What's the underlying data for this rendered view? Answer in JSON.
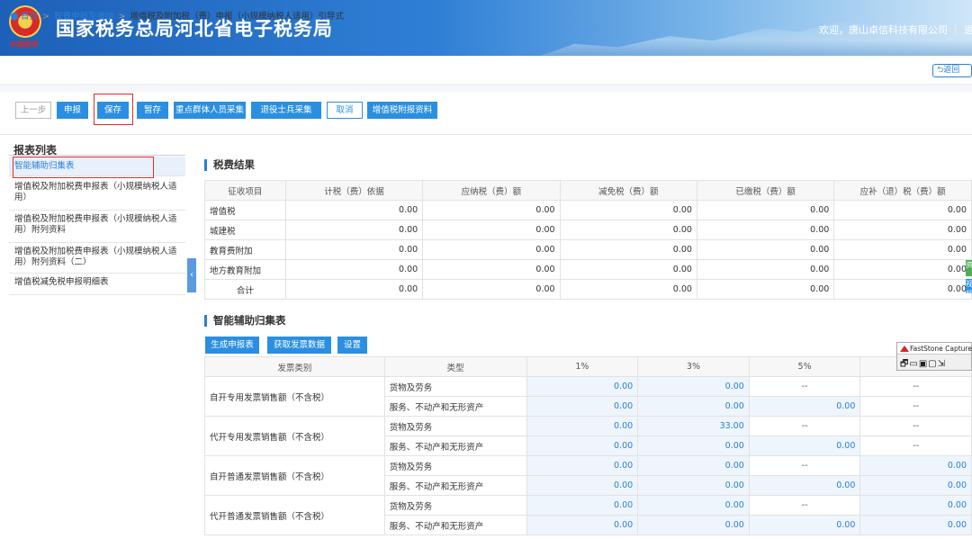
{
  "header": {
    "title": "国家税务总局河北省电子税务局",
    "emblem_text": "中国税务",
    "welcome": "欢迎，唐山卓信科技有限公司 ｜ 退"
  },
  "breadcrumb": {
    "home": "首页",
    "level1": "税费申报及缴纳",
    "current": "增值税及附加税（费）申报（小规模纳税人适用）引导式",
    "back": "返回"
  },
  "toolbar": {
    "prev": "上一步",
    "declare": "申报",
    "save": "保存",
    "temp_save": "暂存",
    "key_group": "重点群体人员采集",
    "veteran": "退役士兵采集",
    "cancel": "取消",
    "vat_attach": "增值税附报资料"
  },
  "sidebar": {
    "title": "报表列表",
    "items": [
      "智能辅助归集表",
      "增值税及附加税费申报表（小规模纳税人适用）",
      "增值税及附加税费申报表（小规模纳税人适用）附列资料",
      "增值税及附加税费申报表（小规模纳税人适用）附列资料（二）",
      "增值税减免税申报明细表"
    ]
  },
  "tax_result": {
    "title": "税费结果",
    "headers": [
      "征收项目",
      "计税（费）依据",
      "应纳税（费）额",
      "减免税（费）额",
      "已缴税（费）额",
      "应补（退）税（费）额"
    ],
    "rows": [
      [
        "增值税",
        "0.00",
        "0.00",
        "0.00",
        "0.00",
        "0.00"
      ],
      [
        "城建税",
        "0.00",
        "0.00",
        "0.00",
        "0.00",
        "0.00"
      ],
      [
        "教育费附加",
        "0.00",
        "0.00",
        "0.00",
        "0.00",
        "0.00"
      ],
      [
        "地方教育附加",
        "0.00",
        "0.00",
        "0.00",
        "0.00",
        "0.00"
      ],
      [
        "合计",
        "0.00",
        "0.00",
        "0.00",
        "0.00",
        "0.00"
      ]
    ]
  },
  "assist": {
    "title": "智能辅助归集表",
    "buttons": [
      "生成申报表",
      "获取发票数据",
      "设置"
    ],
    "headers": [
      "发票类别",
      "类型",
      "1%",
      "3%",
      "5%",
      ""
    ],
    "groups": [
      {
        "category": "自开专用发票销售额（不含税）",
        "rows": [
          {
            "type": "货物及劳务",
            "v1": "0.00",
            "v3": "0.00",
            "v5": "--",
            "v6": "--"
          },
          {
            "type": "服务、不动产和无形资产",
            "v1": "0.00",
            "v3": "0.00",
            "v5": "0.00",
            "v6": "--"
          }
        ]
      },
      {
        "category": "代开专用发票销售额（不含税）",
        "rows": [
          {
            "type": "货物及劳务",
            "v1": "0.00",
            "v3": "33.00",
            "v5": "--",
            "v6": "--"
          },
          {
            "type": "服务、不动产和无形资产",
            "v1": "0.00",
            "v3": "0.00",
            "v5": "0.00",
            "v6": "--"
          }
        ]
      },
      {
        "category": "自开普通发票销售额（不含税）",
        "rows": [
          {
            "type": "货物及劳务",
            "v1": "0.00",
            "v3": "0.00",
            "v5": "--",
            "v6": "0.00"
          },
          {
            "type": "服务、不动产和无形资产",
            "v1": "0.00",
            "v3": "0.00",
            "v5": "0.00",
            "v6": "0.00"
          }
        ]
      },
      {
        "category": "代开普通发票销售额（不含税）",
        "rows": [
          {
            "type": "货物及劳务",
            "v1": "0.00",
            "v3": "0.00",
            "v5": "--",
            "v6": "0.00"
          },
          {
            "type": "服务、不动产和无形资产",
            "v1": "0.00",
            "v3": "0.00",
            "v5": "0.00",
            "v6": "0.00"
          }
        ]
      }
    ]
  },
  "faststone": {
    "title": "FastStone Capture",
    "icons": "🗗▭▣▢⇲"
  },
  "side_tabs": [
    "资",
    "视频"
  ],
  "colors": {
    "primary": "#2a8fe0",
    "highlight_box": "#e02b2b"
  }
}
